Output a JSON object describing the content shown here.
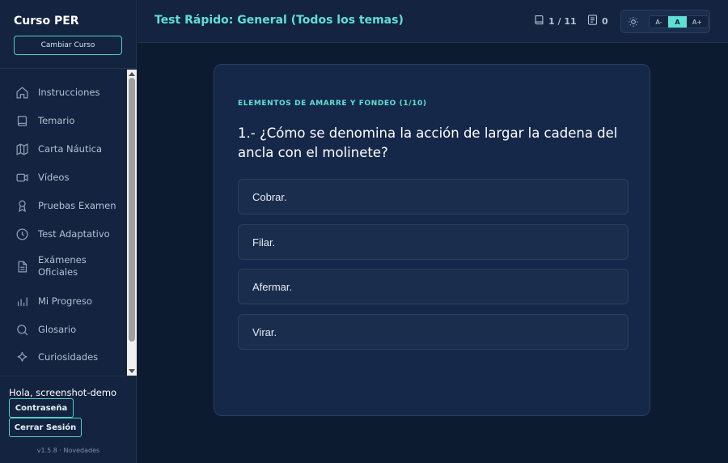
{
  "sidebar": {
    "brand": "Curso PER",
    "change_course": "Cambiar Curso",
    "items": [
      {
        "label": "Instrucciones",
        "icon": "home-icon"
      },
      {
        "label": "Temario",
        "icon": "book-icon"
      },
      {
        "label": "Carta Náutica",
        "icon": "map-icon"
      },
      {
        "label": "Vídeos",
        "icon": "video-icon"
      },
      {
        "label": "Pruebas Examen",
        "icon": "award-icon"
      },
      {
        "label": "Test Adaptativo",
        "icon": "clock-icon"
      },
      {
        "label": "Exámenes Oficiales",
        "icon": "document-icon"
      },
      {
        "label": "Mi Progreso",
        "icon": "bar-chart-icon"
      },
      {
        "label": "Glosario",
        "icon": "search-icon"
      },
      {
        "label": "Curiosidades",
        "icon": "sparkle-icon"
      }
    ],
    "greeting": "Hola, screenshot-demo",
    "password_button": "Contraseña",
    "logout_button": "Cerrar Sesión",
    "version": "v1.5.8 · Novedades"
  },
  "header": {
    "title": "Test Rápido: General (Todos los temas)",
    "progress": "1 / 11",
    "answered": "0",
    "font_small": "A-",
    "font_normal": "A",
    "font_large": "A+"
  },
  "quiz": {
    "topic": "ELEMENTOS DE AMARRE Y FONDEO (1/10)",
    "question": "1.- ¿Cómo se denomina la acción de largar la cadena del ancla con el molinete?",
    "options": [
      "Cobrar.",
      "Filar.",
      "Afermar.",
      "Virar."
    ]
  },
  "colors": {
    "accent": "#5fe0d4",
    "background": "#0d1b30",
    "panel": "#132340"
  }
}
